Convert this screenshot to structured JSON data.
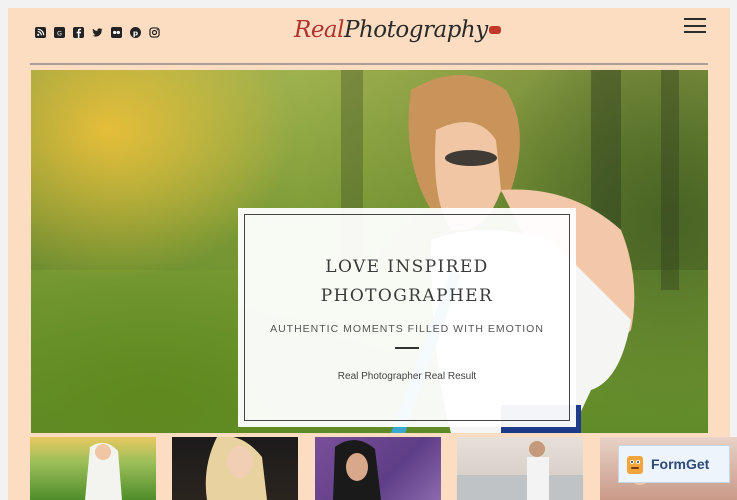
{
  "header": {
    "logo_real": "Real",
    "logo_photography": "Photography",
    "social_icons": [
      "rss-icon",
      "google-plus-icon",
      "facebook-icon",
      "twitter-icon",
      "flickr-icon",
      "pinterest-icon",
      "instagram-icon"
    ],
    "menu_icon": "hamburger-menu-icon"
  },
  "hero": {
    "title": "LOVE INSPIRED PHOTOGRAPHER",
    "subtitle": "AUTHENTIC MOMENTS FILLED WITH EMOTION",
    "text": "Real Photographer Real Result"
  },
  "thumbnails": [
    {
      "label": "",
      "scene": "girl-in-meadow"
    },
    {
      "label": "",
      "scene": "blonde-woman-dark-background"
    },
    {
      "label": "",
      "scene": "woman-purple-background"
    },
    {
      "label": "",
      "scene": "man-by-car"
    },
    {
      "label": "",
      "scene": "portrait"
    }
  ],
  "watermark": {
    "text": "FormGet"
  },
  "colors": {
    "page_background": "#fdddc1",
    "logo_accent": "#b0332f"
  }
}
